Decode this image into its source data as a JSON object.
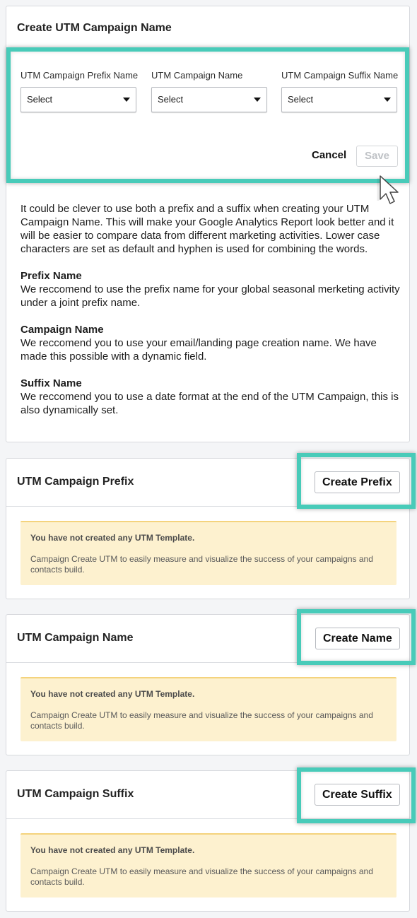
{
  "main": {
    "title": "Create UTM Campaign Name",
    "fields": [
      {
        "label": "UTM Campaign Prefix Name",
        "value": "Select"
      },
      {
        "label": "UTM Campaign Name",
        "value": "Select"
      },
      {
        "label": "UTM Campaign Suffix Name",
        "value": "Select"
      }
    ],
    "cancel_label": "Cancel",
    "save_label": "Save",
    "intro": "It could be clever to use both a prefix and a suffix when creating your UTM Campaign Name. This will make your Google Analytics Report look better and it will be easier to compare data from different marketing activities. Lower case characters are set as default and hyphen is used for combining the words.",
    "tips": [
      {
        "heading": "Prefix Name",
        "text": "We reccomend to use the prefix name for your global seasonal merketing activity under a joint prefix name."
      },
      {
        "heading": "Campaign Name",
        "text": "We reccomend you to use your email/landing page creation name. We have made this possible with a dynamic field."
      },
      {
        "heading": "Suffix Name",
        "text": "We reccomend you to use a date format at the end of the UTM Campaign, this is also dynamically set."
      }
    ]
  },
  "sections": [
    {
      "title": "UTM Campaign Prefix",
      "button_label": "Create Prefix",
      "notice_title": "You have not created any UTM Template.",
      "notice_text": "Campaign Create UTM to easily measure and visualize the success of your campaigns and contacts build."
    },
    {
      "title": "UTM Campaign Name",
      "button_label": "Create Name",
      "notice_title": "You have not created any UTM Template.",
      "notice_text": "Campaign Create UTM to easily measure and visualize the success of your campaigns and contacts build."
    },
    {
      "title": "UTM Campaign Suffix",
      "button_label": "Create Suffix",
      "notice_title": "You have not created any UTM Template.",
      "notice_text": "Campaign Create UTM to easily measure and visualize the success of your campaigns and contacts build."
    }
  ],
  "colors": {
    "highlight": "#48cbb9",
    "notice_bg": "#fdf1cf",
    "notice_border": "#f4d37d"
  },
  "icons": {
    "select_caret": "caret-down-icon",
    "pointer": "cursor-arrow-icon"
  }
}
